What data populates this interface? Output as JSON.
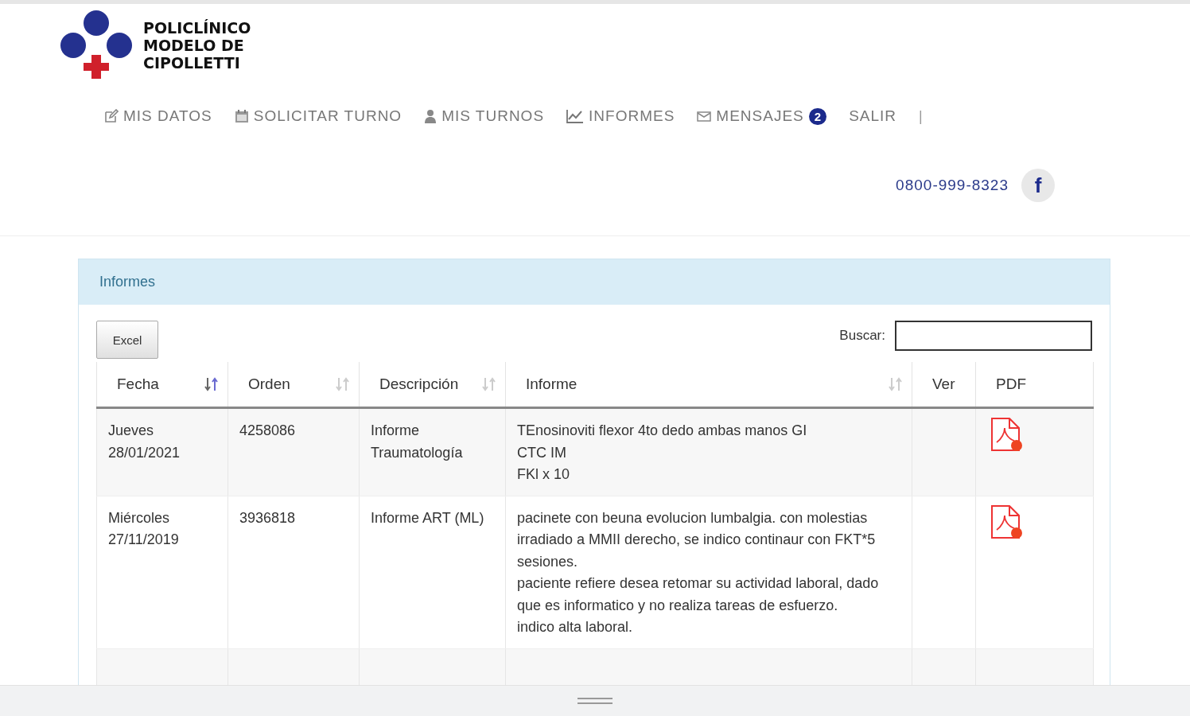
{
  "logo": {
    "lines": [
      "POLICLÍNICO",
      "MODELO DE",
      "CIPOLLETTI"
    ]
  },
  "nav": [
    {
      "label": "MIS DATOS",
      "kind": "edit"
    },
    {
      "label": "SOLICITAR TURNO",
      "kind": "calendar"
    },
    {
      "label": "MIS TURNOS",
      "kind": "user"
    },
    {
      "label": "INFORMES",
      "kind": "chart"
    },
    {
      "label": "MENSAJES",
      "kind": "mail",
      "badge": "2"
    },
    {
      "label": "SALIR",
      "kind": "plain"
    }
  ],
  "nav_separator": "|",
  "phone": "0800-999-8323",
  "facebook": "f",
  "panel": {
    "title": "Informes",
    "excel_button": "Excel",
    "search_label": "Buscar:",
    "table": {
      "columns": [
        {
          "label": "Fecha",
          "kind": "sortable",
          "selected": true
        },
        {
          "label": "Orden",
          "kind": "sortable",
          "selected": false
        },
        {
          "label": "Descripción",
          "kind": "sortable",
          "selected": false
        },
        {
          "label": "Informe",
          "kind": "sortable",
          "selected": false
        },
        {
          "label": "Ver",
          "kind": "plain"
        },
        {
          "label": "PDF",
          "kind": "plain"
        }
      ],
      "rows": [
        {
          "day": "Jueves",
          "date": "28/01/2021",
          "orden": "4258086",
          "descripcion": "Informe Traumatología",
          "informe": [
            "TEnosinoviti flexor 4to dedo ambas manos GI",
            "CTC IM",
            "FKl x 10"
          ],
          "pdf": true
        },
        {
          "day": "Miércoles",
          "date": "27/11/2019",
          "orden": "3936818",
          "descripcion": "Informe ART (ML)",
          "informe": [
            "pacinete con beuna evolucion lumbalgia. con molestias irradiado a MMII derecho, se indico continaur con FKT*5 sesiones.",
            "paciente refiere desea retomar su actividad laboral, dado que es informatico y no realiza tareas de esfuerzo.",
            "indico alta laboral."
          ],
          "pdf": true
        }
      ]
    }
  }
}
